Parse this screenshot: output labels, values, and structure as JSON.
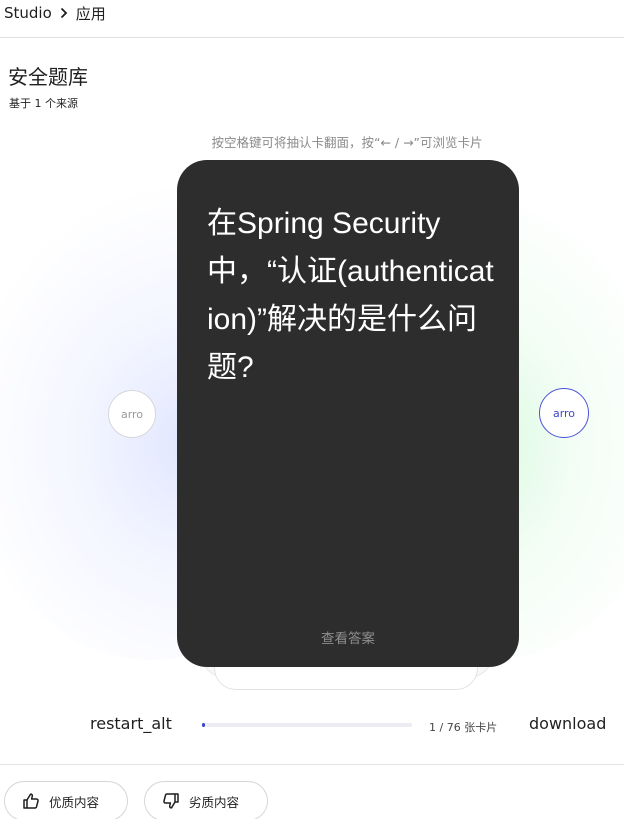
{
  "breadcrumb": {
    "root": "Studio",
    "current": "应用"
  },
  "notebook": {
    "title": "安全题库",
    "source_count_label": "基于 1 个来源"
  },
  "flashcards": {
    "hint": "按空格键可将抽认卡翻面，按“← / →”可浏览卡片",
    "prev_label": "arro",
    "next_label": "arro",
    "question": "在Spring Security中，“认证(authentication)”解决的是什么问题?",
    "reveal_label": "查看答案",
    "restart_label": "restart_alt",
    "download_label": "download",
    "counter": "1 / 76 张卡片",
    "current": 1,
    "total": 76
  },
  "feedback": {
    "good_label": "优质内容",
    "bad_label": "劣质内容"
  },
  "colors": {
    "card_bg": "#2d2d2d",
    "accent": "#3c47c8"
  }
}
